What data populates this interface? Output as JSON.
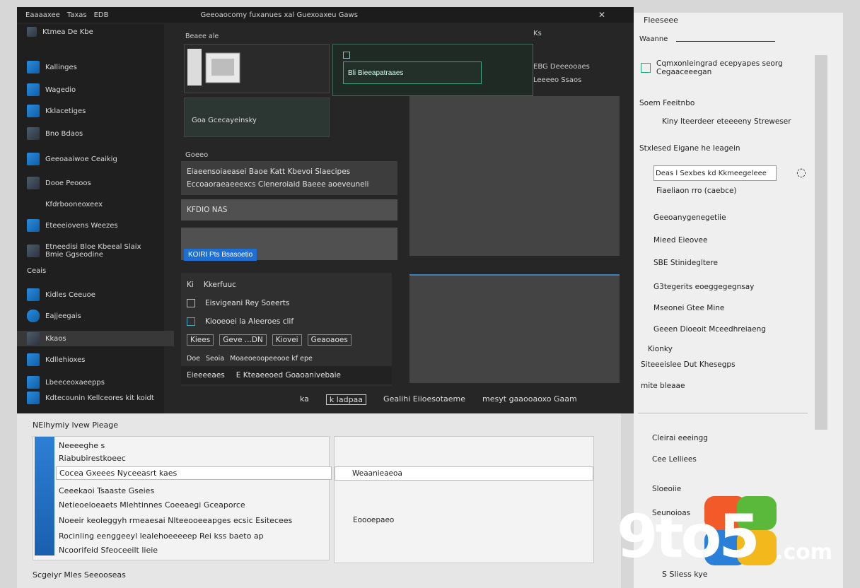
{
  "window": {
    "title": "Geeoaocomy fuxanues xal Guexoaxeu Gaws",
    "app_name": "Eaaaaxee",
    "menu_1": "Taxas",
    "menu_2": "EDB"
  },
  "sidebar": {
    "top_label": "Ktmea De Kbe",
    "items": [
      {
        "label": "Kallinges",
        "icon": "app-icon"
      },
      {
        "label": "Wagedio",
        "icon": "app-icon"
      },
      {
        "label": "Kklacetiges",
        "icon": "app-icon"
      },
      {
        "label": "Bno Bdaos",
        "icon": "app-icon"
      },
      {
        "label": "Geeoaaiwoe Ceaikig",
        "icon": "app-icon"
      },
      {
        "label": "Dooe Peooos",
        "icon": "app-icon"
      },
      {
        "label": "Kfdrbooneoxeex",
        "icon": "app-icon"
      },
      {
        "label": "Eteeeiovens Weezes",
        "icon": "app-icon"
      },
      {
        "label": "Etneedisi Bloe Kbeeal Slaix Bmie Ggseodine",
        "icon": "app-icon"
      }
    ],
    "section_label": "Ceais",
    "section_items": [
      {
        "label": "Kidles Ceeuoe",
        "icon": "app-icon"
      },
      {
        "label": "Eajjeegais",
        "icon": "cloud-icon"
      },
      {
        "label": "Kkaos",
        "icon": "app-icon"
      },
      {
        "label": "Kdllehioxes",
        "icon": "app-icon"
      },
      {
        "label": "Lbeeceoxaeepps",
        "icon": "app-icon"
      },
      {
        "label": "Kdtecounin Kellceores kit koidt",
        "icon": "app-icon"
      }
    ]
  },
  "middle": {
    "small_label": "Beaee ale",
    "card1_caption": "Goa Gcecayeinsky",
    "search_value": "Bli Bieeapatraaes",
    "group_header": "Goeeo",
    "row1": "Eiaeensoiaeasei Baoe Katt Kbevoi Slaecipes",
    "row2": "Eccoaoraeaeeexcs Cleneroiaid Baeee aoeveuneli",
    "row3": "KFDIO NAS",
    "action_button": "KOIRI Pts Bsasoetio",
    "list_header_num": "Ki",
    "list_header": "Kkerfuuc",
    "list1": "Eisvigeani Rey Soeerts",
    "list2": "Kiooeoei la Aleeroes clif",
    "chip1": "Kiees",
    "chip2": "Geve ...DN",
    "chip3": "Kiovei",
    "chip4": "Geaoaoes",
    "sub1": "Doe",
    "sub2": "Seoia",
    "sub3": "Moaeoeoopeeooe kf epe",
    "footer_left": "Eieeeeaes",
    "footer_right": "E Kteaeeoed Goaoanivebaie"
  },
  "topright": {
    "label": "Ks",
    "line": "EBG Deeeooaes",
    "line2": "Leeeeo Ssaos"
  },
  "statusbar": {
    "item1": "ka",
    "item2": "k ladpaa",
    "item3": "Gealihi Eiioesotaeme",
    "item4": "mesyt gaaooaoxo Gaam"
  },
  "right_panel": {
    "title": "Fleeseee",
    "name_label": "Waanne",
    "heading": "Cqmxonleingrad ecepyapes seorg Cegaaceeegan",
    "section": "Soem Feeitnbo",
    "item1": "Kiny lteerdeer eteeeeny Streweser",
    "label2": "Stxlesed Eigane he Ieagein",
    "field": "Deas l Sexbes kd Kkmeegeleee",
    "items": [
      "Fiaeliaon rro (caebce)",
      "Geeoanygenegetiie",
      "Mieed Eieovee",
      "SBE Stinidegltere",
      "G3tegerits eoeggegegnsay",
      "Mseonei Gtee Mine",
      "Geeen Dioeoit Mceedhreiaeng",
      "Kionky",
      "Siteeeislee Dut Khesegps",
      "mite bleaae"
    ],
    "lower_items": [
      "Cleirai eeeingg",
      "Cee Lelliees",
      "Sloeoiie",
      "Seunoioas"
    ]
  },
  "bottom": {
    "title": "NElhymiy lvew Pieage",
    "rows": [
      "Neeeeghe s",
      "Riabubirestkoeec",
      "Cocea Gxeees Nyceeasrt kaes",
      "Ceeekaoi Tsaaste Gseies",
      "Netieoeloeaets Mlehtinnes Coeeaegi Gceaporce",
      "Noeeir keoleggyh rmeaesai Nlteeooeeapges ecsic Esitecees",
      "Rocinling eenggeeyl lealehoeeeeep Rei kss baeto ap",
      "Ncoorifeid Sfeoceeilt lieie"
    ],
    "right_row": "Weaanieaeoa",
    "right_hint": "Eoooepaeo",
    "footer_left": "Scgeiyr Mles Seeooseas",
    "footer_right": "S Sliess kye"
  },
  "watermark": {
    "text_main": "9to5",
    "text_dot": ".com"
  }
}
